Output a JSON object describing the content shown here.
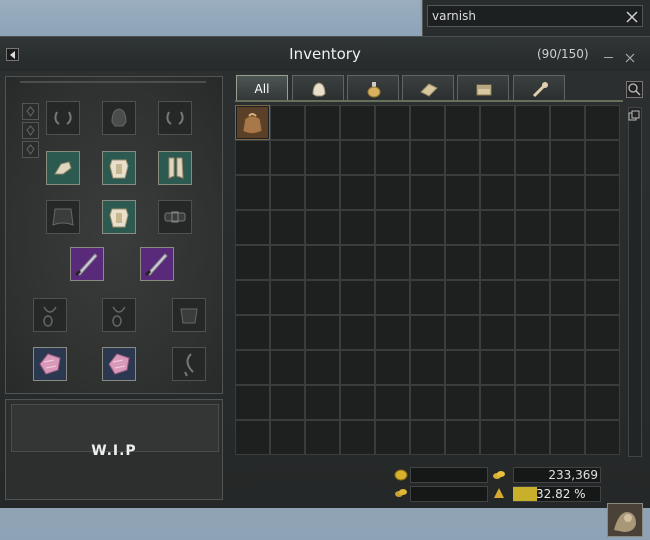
{
  "search": {
    "value": "varnish",
    "placeholder": ""
  },
  "window": {
    "title": "Inventory",
    "capacity": "(90/150)"
  },
  "tabs": [
    {
      "label": "All",
      "icon": "all"
    },
    {
      "label": "",
      "icon": "armor-helmet-icon"
    },
    {
      "label": "",
      "icon": "potion-icon"
    },
    {
      "label": "",
      "icon": "material-scroll-icon"
    },
    {
      "label": "",
      "icon": "chest-box-icon"
    },
    {
      "label": "",
      "icon": "misc-item-icon"
    }
  ],
  "equipment": {
    "slots": [
      {
        "name": "head-left",
        "icon": "ear-accessory-icon",
        "filled": false
      },
      {
        "name": "head",
        "icon": "helmet-icon",
        "filled": false
      },
      {
        "name": "head-right",
        "icon": "ear-accessory-icon",
        "filled": false
      },
      {
        "name": "gloves",
        "icon": "gloves-icon",
        "filled": true
      },
      {
        "name": "chest",
        "icon": "chest-armor-icon",
        "filled": true
      },
      {
        "name": "boots",
        "icon": "boots-icon",
        "filled": true
      },
      {
        "name": "cape",
        "icon": "cape-icon",
        "filled": false
      },
      {
        "name": "costume",
        "icon": "costume-armor-icon",
        "filled": true
      },
      {
        "name": "belt",
        "icon": "belt-icon",
        "filled": false
      },
      {
        "name": "main-weapon",
        "icon": "purple-dagger-icon",
        "filled": true
      },
      {
        "name": "off-weapon",
        "icon": "purple-dagger-icon",
        "filled": true
      },
      {
        "name": "necklace-1",
        "icon": "necklace-icon",
        "filled": false
      },
      {
        "name": "necklace-2",
        "icon": "necklace-icon",
        "filled": false
      },
      {
        "name": "shoulder",
        "icon": "shoulder-guard-icon",
        "filled": false
      },
      {
        "name": "ring-1",
        "icon": "pink-crystal-icon",
        "filled": true
      },
      {
        "name": "ring-2",
        "icon": "pink-crystal-icon",
        "filled": true
      },
      {
        "name": "earring",
        "icon": "hook-accessory-icon",
        "filled": false
      }
    ],
    "wip_label": "W.I.P"
  },
  "inventory": {
    "columns": 11,
    "rows": 10,
    "items": [
      {
        "index": 0,
        "icon": "pouch-bag-icon"
      }
    ]
  },
  "currency": {
    "silver": "233,369",
    "xp_percent": "32.82 %",
    "xp_fraction": 0.3282
  },
  "colors": {
    "accent": "#c8b02a",
    "window_bg": "#2a2e2e",
    "grid_bg": "#1e2020"
  }
}
